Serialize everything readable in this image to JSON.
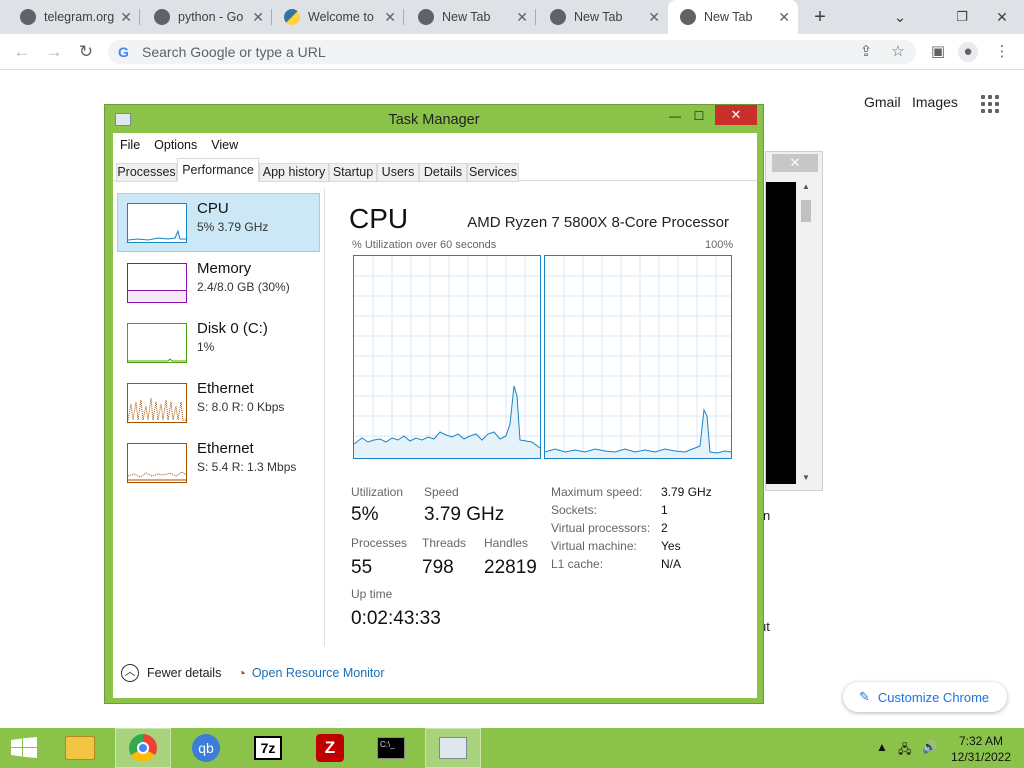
{
  "browser": {
    "tabs": [
      {
        "title": "telegram.org",
        "icon": "globe-icon"
      },
      {
        "title": "python - Go",
        "icon": "globe-icon"
      },
      {
        "title": "Welcome to",
        "icon": "python-icon"
      },
      {
        "title": "New Tab",
        "icon": "chrome-icon"
      },
      {
        "title": "New Tab",
        "icon": "chrome-icon"
      },
      {
        "title": "New Tab",
        "icon": "chrome-icon"
      }
    ],
    "new_tab_symbol": "+",
    "address_placeholder": "Search Google or type a URL",
    "g_logo": "G",
    "links": {
      "gmail": "Gmail",
      "images": "Images"
    },
    "customize_label": "Customize Chrome",
    "bg_text_1": "n",
    "bg_text_2": "ut"
  },
  "taskmanager": {
    "title": "Task Manager",
    "menu": [
      "File",
      "Options",
      "View"
    ],
    "tabs": [
      "Processes",
      "Performance",
      "App history",
      "Startup",
      "Users",
      "Details",
      "Services"
    ],
    "active_tab": "Performance",
    "resources": [
      {
        "name": "CPU",
        "sub": "5%  3.79 GHz",
        "color": "#1a83c6"
      },
      {
        "name": "Memory",
        "sub": "2.4/8.0 GB (30%)",
        "color": "#8b12ae"
      },
      {
        "name": "Disk 0 (C:)",
        "sub": "1%",
        "color": "#4da60c"
      },
      {
        "name": "Ethernet",
        "sub": "S: 8.0  R: 0 Kbps",
        "color": "#a74f01"
      },
      {
        "name": "Ethernet",
        "sub": "S: 5.4  R: 1.3 Mbps",
        "color": "#a74f01"
      }
    ],
    "detail": {
      "heading": "CPU",
      "processor": "AMD Ryzen 7 5800X 8-Core Processor",
      "graph_label": "% Utilization over 60 seconds",
      "graph_max": "100%",
      "stats": {
        "utilization_label": "Utilization",
        "utilization": "5%",
        "speed_label": "Speed",
        "speed": "3.79 GHz",
        "processes_label": "Processes",
        "processes": "55",
        "threads_label": "Threads",
        "threads": "798",
        "handles_label": "Handles",
        "handles": "22819",
        "uptime_label": "Up time",
        "uptime": "0:02:43:33"
      },
      "specs": [
        {
          "k": "Maximum speed:",
          "v": "3.79 GHz"
        },
        {
          "k": "Sockets:",
          "v": "1"
        },
        {
          "k": "Virtual processors:",
          "v": "2"
        },
        {
          "k": "Virtual machine:",
          "v": "Yes"
        },
        {
          "k": "L1 cache:",
          "v": "N/A"
        }
      ]
    },
    "footer": {
      "fewer": "Fewer details",
      "monitor": "Open Resource Monitor"
    }
  },
  "taskbar": {
    "apps": [
      "chrome-icon",
      "qbittorrent-icon",
      "7zip-icon",
      "filezilla-icon",
      "cmd-icon",
      "taskmanager-icon"
    ],
    "qb_label": "qb",
    "sevenzip_label": "7z",
    "cmd_label": "C:\\_",
    "time": "7:32 AM",
    "date": "12/31/2022"
  }
}
